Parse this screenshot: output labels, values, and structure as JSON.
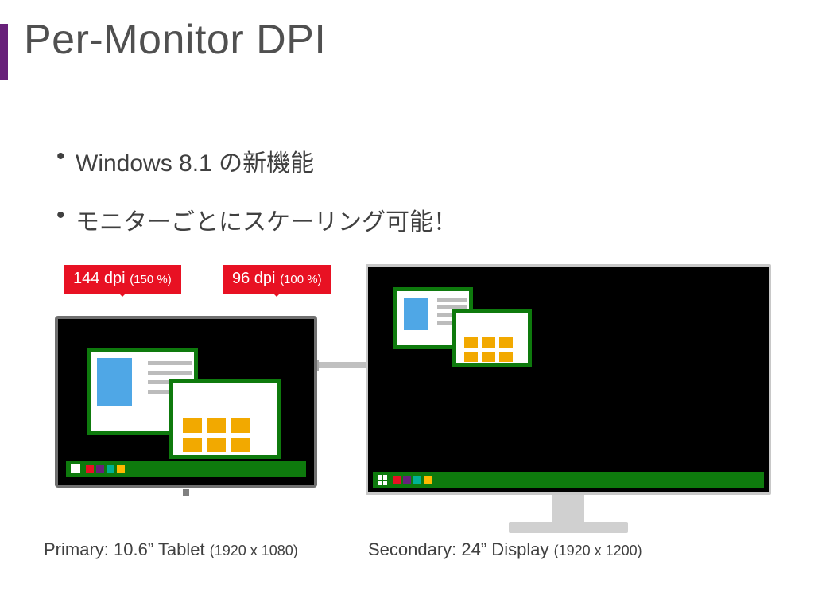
{
  "title": "Per-Monitor DPI",
  "bullets": [
    "Windows 8.1 の新機能",
    "モニターごとにスケーリング可能！"
  ],
  "callouts": {
    "primary": {
      "dpi": "144 dpi",
      "pct": "(150 %)"
    },
    "secondary": {
      "dpi": "96 dpi",
      "pct": "(100 %)"
    }
  },
  "captions": {
    "primary": {
      "main": "Primary: 10.6” Tablet ",
      "sub": "(1920 x 1080)"
    },
    "secondary": {
      "main": "Secondary: 24” Display ",
      "sub": "(1920 x 1200)"
    }
  },
  "colors": {
    "accent": "#68217A",
    "callout_bg": "#E81123",
    "win_green": "#0E7A0D",
    "tile_orange": "#F2A900",
    "thumb_blue": "#4FA7E6"
  }
}
